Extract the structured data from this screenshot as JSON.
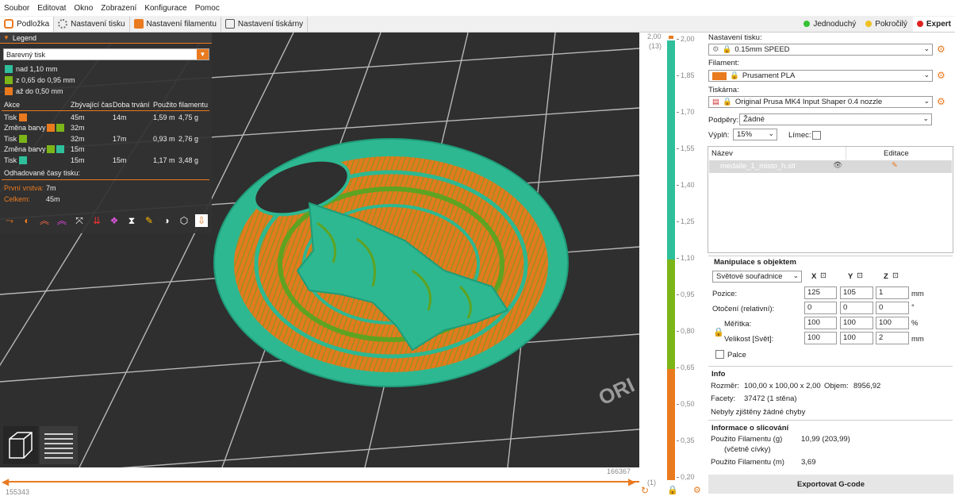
{
  "menu": [
    "Soubor",
    "Editovat",
    "Okno",
    "Zobrazení",
    "Konfigurace",
    "Pomoc"
  ],
  "tabs": [
    {
      "label": "Podložka",
      "icon": "bed-icon"
    },
    {
      "label": "Nastavení tisku",
      "icon": "gear-icon"
    },
    {
      "label": "Nastavení filamentu",
      "icon": "spool-icon"
    },
    {
      "label": "Nastavení tiskárny",
      "icon": "printer-icon"
    }
  ],
  "modes": [
    {
      "label": "Jednoduchý",
      "color": "#33c233"
    },
    {
      "label": "Pokročilý",
      "color": "#f0c020"
    },
    {
      "label": "Expert",
      "color": "#e02020"
    }
  ],
  "legend": {
    "title": "Legend",
    "view_type": "Barevný tisk",
    "ranges": [
      {
        "label": "nad 1,10 mm",
        "color": "#2fbf9a"
      },
      {
        "label": "z 0,65 do 0,95 mm",
        "color": "#7cb518"
      },
      {
        "label": "až do 0,50 mm",
        "color": "#ea7a1f"
      }
    ],
    "table_headers": [
      "Akce",
      "Zbývající čas",
      "Doba trvání",
      "Použito filamentu"
    ],
    "rows": [
      {
        "action": "Tisk",
        "colors": [
          "#ea7a1f"
        ],
        "remaining": "45m",
        "duration": "14m",
        "length": "1,59 m",
        "weight": "4,75 g"
      },
      {
        "action": "Změna barvy",
        "colors": [
          "#ea7a1f",
          "#7cb518"
        ],
        "remaining": "32m",
        "duration": "",
        "length": "",
        "weight": ""
      },
      {
        "action": "Tisk",
        "colors": [
          "#7cb518"
        ],
        "remaining": "32m",
        "duration": "17m",
        "length": "0,93 m",
        "weight": "2,76 g"
      },
      {
        "action": "Změna barvy",
        "colors": [
          "#7cb518",
          "#2fbf9a"
        ],
        "remaining": "15m",
        "duration": "",
        "length": "",
        "weight": ""
      },
      {
        "action": "Tisk",
        "colors": [
          "#2fbf9a"
        ],
        "remaining": "15m",
        "duration": "15m",
        "length": "1,17 m",
        "weight": "3,48 g"
      }
    ],
    "estimated_label": "Odhadované časy tisku:",
    "first_layer_label": "První vrstva:",
    "first_layer_value": "7m",
    "total_label": "Celkem:",
    "total_value": "45m"
  },
  "viewport": {
    "hslider_left": "155343",
    "hslider_right": "166367",
    "watermark": "ORI"
  },
  "vslider": {
    "top_value": "2,00",
    "top_index": "(13)",
    "bottom_value": "0,20",
    "bottom_index": "(1)",
    "ticks": [
      "2,00",
      "1,85",
      "1,70",
      "1,55",
      "1,40",
      "1,25",
      "1,10",
      "0,95",
      "0,80",
      "0,65",
      "0,50",
      "0,35",
      "0,20"
    ],
    "color_bands": [
      {
        "from": "2,00",
        "to": "1,10",
        "color": "#2fbf9a"
      },
      {
        "from": "1,10",
        "to": "0,65",
        "color": "#7cb518"
      },
      {
        "from": "0,65",
        "to": "0,20",
        "color": "#ea7a1f"
      }
    ]
  },
  "right": {
    "print_settings_label": "Nastavení tisku:",
    "print_profile": "0.15mm SPEED",
    "filament_label": "Filament:",
    "filament_profile": "Prusament PLA",
    "filament_color": "#ea7a1f",
    "printer_label": "Tiskárna:",
    "printer_profile": "Original Prusa MK4 Input Shaper 0.4 nozzle",
    "supports_label": "Podpěry:",
    "supports_value": "Žádné",
    "infill_label": "Výplň:",
    "infill_value": "15%",
    "brim_label": "Límec:",
    "objects_col_name": "Název",
    "objects_col_edit": "Editace",
    "object_name": "medaile_1_misto_h.stl",
    "manip_header": "Manipulace s objektem",
    "coord_system": "Světové souřadnice",
    "axis_x": "X",
    "axis_y": "Y",
    "axis_z": "Z",
    "position_label": "Pozice:",
    "position": [
      "125",
      "105",
      "1"
    ],
    "position_unit": "mm",
    "rotation_label": "Otočení (relativní):",
    "rotation": [
      "0",
      "0",
      "0"
    ],
    "rotation_unit": "°",
    "scale_label": "Měřítka:",
    "scale": [
      "100",
      "100",
      "100"
    ],
    "scale_unit": "%",
    "size_label": "Velikost [Svět]:",
    "size": [
      "100",
      "100",
      "2"
    ],
    "size_unit": "mm",
    "inches_label": "Palce",
    "info_header": "Info",
    "size_info_label": "Rozměr:",
    "size_info_value": "100,00 x 100,00 x 2,00",
    "volume_label": "Objem:",
    "volume_value": "8956,92",
    "facets_label": "Facety:",
    "facets_value": "37472 (1 stěna)",
    "errors_text": "Nebyly zjištěny žádné chyby",
    "slicing_header": "Informace o slicování",
    "filament_g_label": "Použito Filamentu (g)",
    "filament_g_sub": "(včetně cívky)",
    "filament_g_value": "10,99 (203,99)",
    "filament_m_label": "Použito Filamentu (m)",
    "filament_m_value": "3,69",
    "export_button": "Exportovat G-code"
  }
}
